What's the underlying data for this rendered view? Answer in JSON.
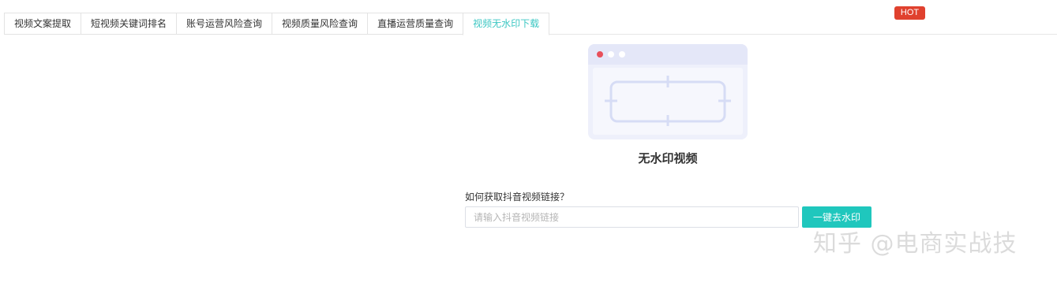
{
  "tabs": [
    {
      "label": "视频文案提取",
      "active": false
    },
    {
      "label": "短视频关键词排名",
      "active": false
    },
    {
      "label": "账号运营风险查询",
      "active": false
    },
    {
      "label": "视频质量风险查询",
      "active": false
    },
    {
      "label": "直播运营质量查询",
      "active": false
    },
    {
      "label": "视频无水印下载",
      "active": true
    }
  ],
  "hot_badge": "HOT",
  "empty_state": {
    "title": "无水印视频"
  },
  "help_link": "如何获取抖音视频链接？",
  "url_input": {
    "value": "",
    "placeholder": "请输入抖音视频链接"
  },
  "submit_button": "一键去水印",
  "watermark": {
    "text": "知乎 @电商实战技"
  },
  "colors": {
    "accent": "#1fc7bd",
    "active_tab_text": "#3cc7c3",
    "hot_badge": "#e0412e",
    "illustration_frame": "#d6dcf5"
  }
}
